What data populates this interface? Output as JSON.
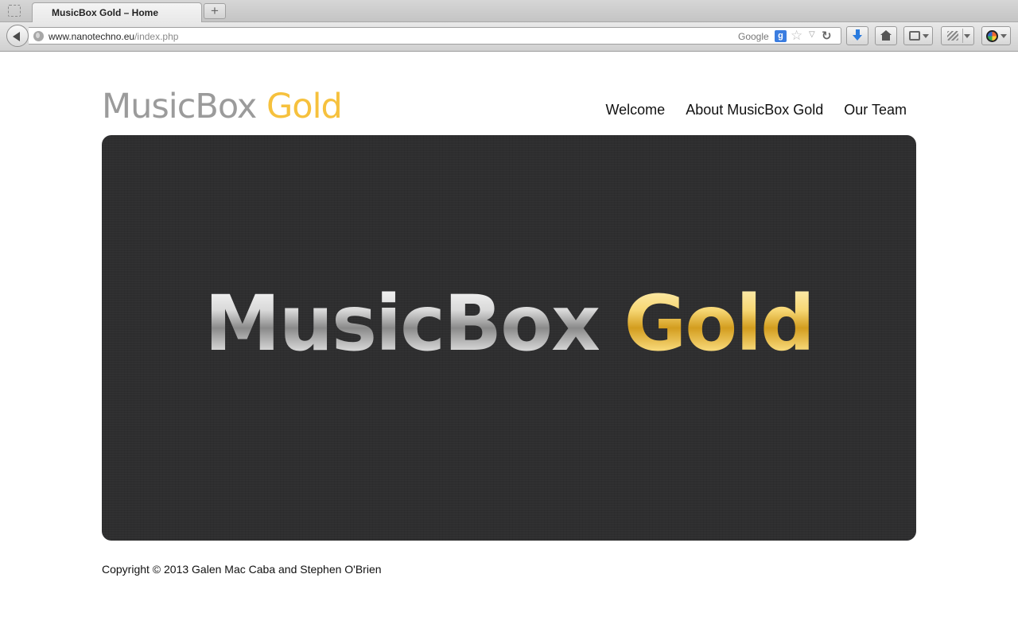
{
  "browser": {
    "tab_title": "MusicBox Gold – Home",
    "new_tab_label": "+",
    "url_host": "www.nanotechno.eu",
    "url_path": "/index.php",
    "search_engine": "Google",
    "search_engine_badge": "g"
  },
  "header": {
    "logo_main": "MusicBox",
    "logo_accent": "Gold",
    "logo_accent_color": "#f6c13d",
    "nav": [
      {
        "label": "Welcome"
      },
      {
        "label": "About MusicBox Gold"
      },
      {
        "label": "Our Team"
      }
    ]
  },
  "hero": {
    "logo_main": "MusicBox",
    "logo_accent": "Gold",
    "background_color": "#2e2e2f"
  },
  "footer": {
    "copyright": "Copyright © 2013 Galen Mac Caba and Stephen O'Brien"
  },
  "icons": [
    "tab-preview-icon",
    "back-icon",
    "globe-icon",
    "star-icon",
    "reload-icon",
    "download-icon",
    "home-icon",
    "bookmarks-icon",
    "tools-icon",
    "profile-icon"
  ]
}
